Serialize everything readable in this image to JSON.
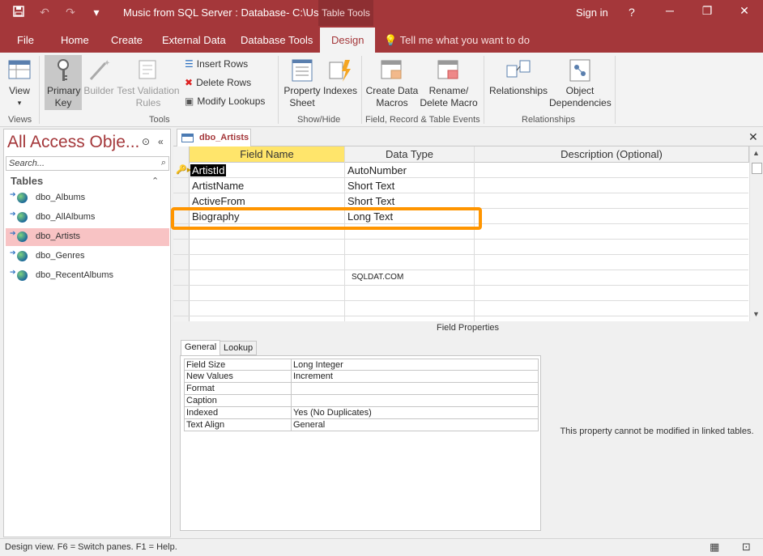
{
  "titlebar": {
    "save_icon": "save-icon",
    "undo_icon": "undo-icon",
    "redo_icon": "redo-icon",
    "title": "Music from SQL Server : Database- C:\\Use...",
    "context_tab": "Table Tools",
    "sign_in": "Sign in",
    "help": "?",
    "minimize": "─",
    "restore": "❐",
    "close": "✕"
  },
  "tabs": {
    "file": "File",
    "home": "Home",
    "create": "Create",
    "external": "External Data",
    "dbtools": "Database Tools",
    "design": "Design",
    "tellme": "Tell me what you want to do"
  },
  "ribbon": {
    "view": "View",
    "view_dd": "▾",
    "primary_key": "Primary Key",
    "builder": "Builder",
    "test_validation": "Test Validation Rules",
    "insert_rows": "Insert Rows",
    "delete_rows": "Delete Rows",
    "modify_lookups": "Modify Lookups",
    "property_sheet": "Property Sheet",
    "indexes": "Indexes",
    "create_data_macros": "Create Data Macros",
    "rename_delete_macro": "Rename/ Delete Macro",
    "relationships": "Relationships",
    "object_dependencies": "Object Dependencies",
    "group_views": "Views",
    "group_tools": "Tools",
    "group_showhide": "Show/Hide",
    "group_events": "Field, Record & Table Events",
    "group_relationships": "Relationships"
  },
  "nav": {
    "header": "All Access Obje...",
    "search_placeholder": "Search...",
    "category": "Tables",
    "items": [
      {
        "label": "dbo_Albums",
        "selected": false
      },
      {
        "label": "dbo_AllAlbums",
        "selected": false
      },
      {
        "label": "dbo_Artists",
        "selected": true
      },
      {
        "label": "dbo_Genres",
        "selected": false
      },
      {
        "label": "dbo_RecentAlbums",
        "selected": false
      }
    ]
  },
  "document": {
    "tab_label": "dbo_Artists",
    "columns": {
      "field_name": "Field Name",
      "data_type": "Data Type",
      "description": "Description (Optional)"
    },
    "rows": [
      {
        "field": "ArtistId",
        "type": "AutoNumber",
        "primary_key": true
      },
      {
        "field": "ArtistName",
        "type": "Short Text"
      },
      {
        "field": "ActiveFrom",
        "type": "Short Text"
      },
      {
        "field": "Biography",
        "type": "Long Text",
        "highlighted": true
      }
    ],
    "watermark": "SQLDAT.COM"
  },
  "field_properties": {
    "label": "Field Properties",
    "tabs": [
      "General",
      "Lookup"
    ],
    "active_tab": "General",
    "props": [
      {
        "key": "Field Size",
        "value": "Long Integer"
      },
      {
        "key": "New Values",
        "value": "Increment"
      },
      {
        "key": "Format",
        "value": ""
      },
      {
        "key": "Caption",
        "value": ""
      },
      {
        "key": "Indexed",
        "value": "Yes (No Duplicates)"
      },
      {
        "key": "Text Align",
        "value": "General"
      }
    ],
    "help_text": "This property cannot be modified in linked tables."
  },
  "status": {
    "text": "Design view.  F6 = Switch panes.  F1 = Help."
  },
  "colors": {
    "accent": "#a4373a",
    "highlight_border": "#ff9500",
    "selected_item": "#f8c3c4",
    "header_selected": "#ffe56b"
  }
}
